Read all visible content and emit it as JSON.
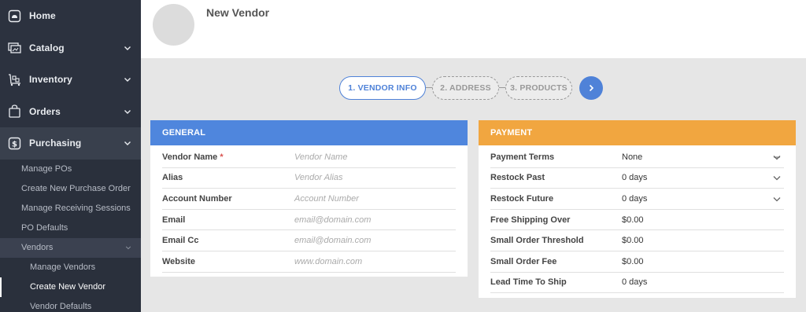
{
  "sidebar": {
    "items": [
      {
        "label": "Home",
        "icon": "home-icon"
      },
      {
        "label": "Catalog",
        "icon": "catalog-icon"
      },
      {
        "label": "Inventory",
        "icon": "inventory-cart-icon"
      },
      {
        "label": "Orders",
        "icon": "orders-bag-icon"
      },
      {
        "label": "Purchasing",
        "icon": "dollar-icon"
      }
    ],
    "purchasing_sub": [
      "Manage POs",
      "Create New Purchase Order",
      "Manage Receiving Sessions",
      "PO Defaults"
    ],
    "vendors_group": "Vendors",
    "vendors_sub": [
      "Manage Vendors",
      "Create New Vendor",
      "Vendor Defaults"
    ]
  },
  "header": {
    "title": "New Vendor"
  },
  "steps": [
    "1. VENDOR INFO",
    "2. ADDRESS",
    "3. PRODUCTS"
  ],
  "general": {
    "title": "GENERAL",
    "rows": [
      {
        "label": "Vendor Name",
        "required": "*",
        "placeholder": "Vendor Name"
      },
      {
        "label": "Alias",
        "placeholder": "Vendor Alias"
      },
      {
        "label": "Account Number",
        "placeholder": "Account Number"
      },
      {
        "label": "Email",
        "placeholder": "email@domain.com"
      },
      {
        "label": "Email Cc",
        "placeholder": "email@domain.com"
      },
      {
        "label": "Website",
        "placeholder": "www.domain.com"
      }
    ]
  },
  "payment": {
    "title": "PAYMENT",
    "rows": [
      {
        "label": "Payment Terms",
        "value": "None"
      },
      {
        "label": "Restock Past",
        "value": "0 days"
      },
      {
        "label": "Restock Future",
        "value": "0 days"
      },
      {
        "label": "Free Shipping Over",
        "value": "$0.00"
      },
      {
        "label": "Small Order Threshold",
        "value": "$0.00"
      },
      {
        "label": "Small Order Fee",
        "value": "$0.00"
      },
      {
        "label": "Lead Time To Ship",
        "value": "0 days"
      }
    ]
  },
  "colors": {
    "sidebar_bg": "#2c323f",
    "accent_blue": "#4f86dd",
    "accent_orange": "#f1a640",
    "required_red": "#d9534f"
  }
}
